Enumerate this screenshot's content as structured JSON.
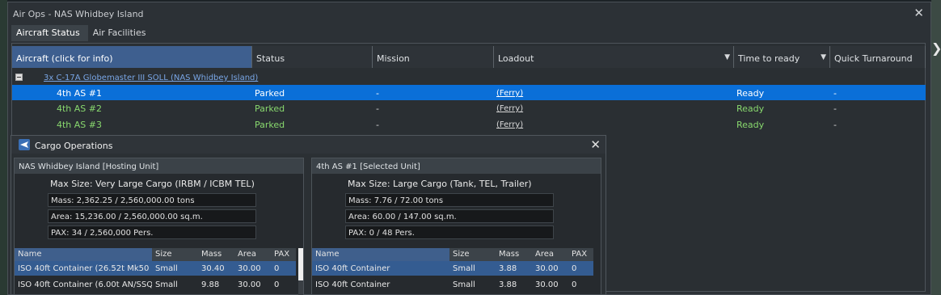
{
  "window": {
    "title": "Air Ops - NAS Whidbey Island"
  },
  "tabs": [
    {
      "label": "Aircraft Status"
    },
    {
      "label": "Air Facilities"
    }
  ],
  "columns": {
    "aircraft": "Aircraft (click for info)",
    "status": "Status",
    "mission": "Mission",
    "loadout": "Loadout",
    "time_to_ready": "Time to ready",
    "quick_turnaround": "Quick Turnaround"
  },
  "group": {
    "label": "3x C-17A Globemaster III SOLL (NAS Whidbey Island)"
  },
  "aircraft": [
    {
      "name": "4th AS #1",
      "status": "Parked",
      "mission": "-",
      "loadout": "(Ferry)",
      "ready": "Ready",
      "quick": "-"
    },
    {
      "name": "4th AS #2",
      "status": "Parked",
      "mission": "-",
      "loadout": "(Ferry)",
      "ready": "Ready",
      "quick": "-"
    },
    {
      "name": "4th AS #3",
      "status": "Parked",
      "mission": "-",
      "loadout": "(Ferry)",
      "ready": "Ready",
      "quick": "-"
    }
  ],
  "cargo": {
    "title": "Cargo Operations",
    "host": {
      "header": "NAS Whidbey Island [Hosting Unit]",
      "max_size": "Max Size: Very Large Cargo (IRBM / ICBM TEL)",
      "mass": "Mass: 2,362.25 / 2,560,000.00 tons",
      "area": "Area: 15,236.00 / 2,560,000.00 sq.m.",
      "pax": "PAX: 34 / 2,560,000 Pers."
    },
    "selected": {
      "header": "4th AS #1 [Selected Unit]",
      "max_size": "Max Size: Large Cargo (Tank, TEL, Trailer)",
      "mass": "Mass: 7.76 / 72.00 tons",
      "area": "Area: 60.00 / 147.00 sq.m.",
      "pax": "PAX: 0 / 48 Pers."
    },
    "table_headers": {
      "name": "Name",
      "size": "Size",
      "mass": "Mass",
      "area": "Area",
      "pax": "PAX"
    },
    "host_rows": [
      {
        "name": "ISO 40ft Container (26.52t Mk50 B...",
        "size": "Small",
        "mass": "30.40",
        "area": "30.00",
        "pax": "0"
      },
      {
        "name": "ISO 40ft Container (6.00t AN/SSQ...",
        "size": "Small",
        "mass": "9.88",
        "area": "30.00",
        "pax": "0"
      }
    ],
    "sel_rows": [
      {
        "name": "ISO 40ft Container",
        "size": "Small",
        "mass": "3.88",
        "area": "30.00",
        "pax": "0"
      },
      {
        "name": "ISO 40ft Container",
        "size": "Small",
        "mass": "3.88",
        "area": "30.00",
        "pax": "0"
      }
    ]
  }
}
